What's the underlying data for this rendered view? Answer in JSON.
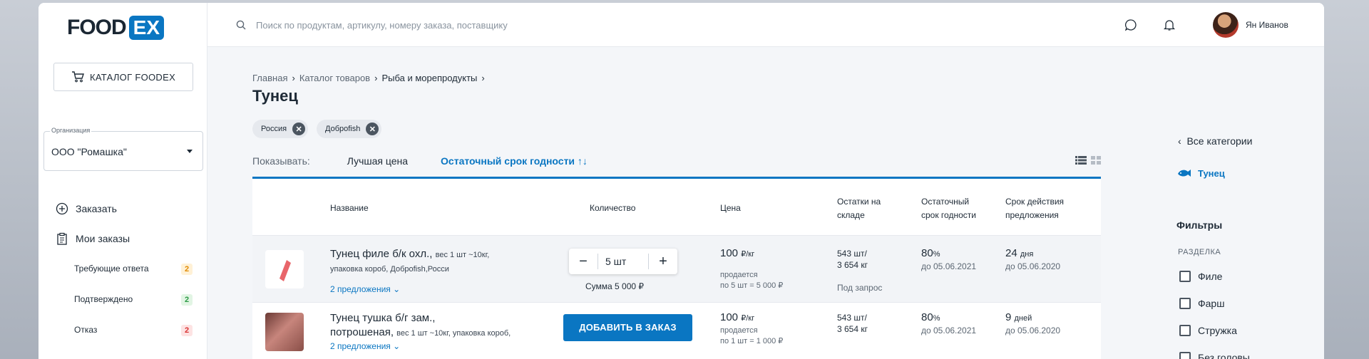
{
  "logo": {
    "food": "FOOD",
    "ex": "EX"
  },
  "sidebar": {
    "catalog_button": "КАТАЛОГ FOODEX",
    "org_label": "Организация",
    "org_value": "ООО \"Ромашка\"",
    "menu": [
      {
        "label": "Заказать",
        "icon": "plus-circle-icon"
      },
      {
        "label": "Мои заказы",
        "icon": "clipboard-icon"
      }
    ],
    "sub_items": [
      {
        "label": "Требующие ответа",
        "count": "2"
      },
      {
        "label": "Подтверждено",
        "count": "2"
      },
      {
        "label": "Отказ",
        "count": "2"
      }
    ]
  },
  "topbar": {
    "search_placeholder": "Поиск по продуктам, артикулу, номеру заказа, поставщику",
    "user_name": "Ян Иванов"
  },
  "breadcrumb": {
    "items": [
      "Главная",
      "Каталог товаров",
      "Рыба и морепродукты"
    ]
  },
  "page_title": "Тунец",
  "chips": [
    "Россия",
    "Добрofish"
  ],
  "sort": {
    "label": "Показывать:",
    "options": [
      "Лучшая цена",
      "Остаточный срок годности ↑↓"
    ]
  },
  "table": {
    "headers": {
      "name": "Название",
      "qty": "Количество",
      "price": "Цена",
      "stock_1": "Остатки на",
      "stock_2": "складе",
      "shelf_1": "Остаточный",
      "shelf_2": "срок годности",
      "valid_1": "Срок действия",
      "valid_2": "предложения"
    },
    "rows": [
      {
        "name": "Тунец филе б/к охл.,",
        "details_1": "вес 1 шт ~10кг,",
        "details_2": "упаковка короб, Добрofish,Росси",
        "offers": "2 предложения",
        "qty": "5 шт",
        "sum": "Сумма 5 000 ₽",
        "price": "100",
        "price_unit": "₽/кг",
        "price_note_1": "продается",
        "price_note_2": "по 5 шт = 5 000 ₽",
        "stock_1": "543 шт/",
        "stock_2": "3 654 кг",
        "stock_link": "Под запрос",
        "shelf_pct": "80",
        "shelf_unit": "%",
        "shelf_date": "до 05.06.2021",
        "valid_days": "24",
        "valid_unit": "дня",
        "valid_date": "до 05.06.2020"
      },
      {
        "name_1": "Тунец тушка б/г зам.,",
        "name_2": "потрошеная,",
        "details": "вес 1 шт ~10кг, упаковка короб,",
        "offers": "2 предложения",
        "add_button": "ДОБАВИТЬ В ЗАКАЗ",
        "price": "100",
        "price_unit": "₽/кг",
        "price_note_1": "продается",
        "price_note_2": "по 1 шт = 1 000 ₽",
        "stock_1": "543 шт/",
        "stock_2": "3 654 кг",
        "shelf_pct": "80",
        "shelf_unit": "%",
        "shelf_date": "до 05.06.2021",
        "valid_days": "9",
        "valid_unit": "дней",
        "valid_date": "до 05.06.2020"
      }
    ]
  },
  "right_panel": {
    "back_link": "Все категории",
    "current_category": "Тунец",
    "filters_title": "Фильтры",
    "group": "РАЗДЕЛКА",
    "options": [
      "Филе",
      "Фарш",
      "Стружка",
      "Без головы"
    ]
  },
  "colors": {
    "accent": "#0a76c2",
    "text": "#1e2a36",
    "muted": "#5c6773"
  }
}
